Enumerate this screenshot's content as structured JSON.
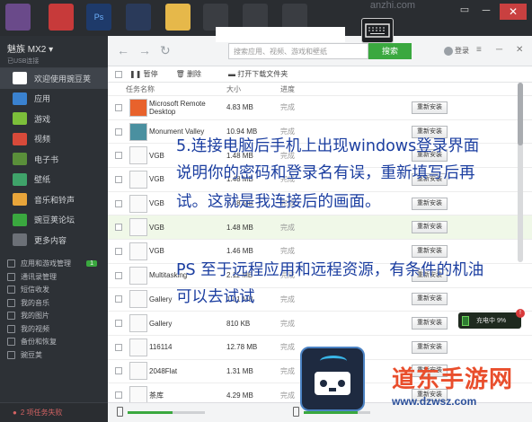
{
  "taskbar": {
    "watermark": "anzhi.com",
    "min_label": "─",
    "max_label": "▭",
    "close_label": "✕"
  },
  "device": {
    "name": "魅族 MX2 ▾",
    "subtitle": "已USB连接"
  },
  "menu": [
    {
      "label": "欢迎使用豌豆荚",
      "color": "#ffffff"
    },
    {
      "label": "应用",
      "color": "#3a82d0"
    },
    {
      "label": "游戏",
      "color": "#7cbf3a"
    },
    {
      "label": "视频",
      "color": "#d84a3a"
    },
    {
      "label": "电子书",
      "color": "#5a8f3a"
    },
    {
      "label": "壁纸",
      "color": "#3fa36a"
    },
    {
      "label": "音乐和铃声",
      "color": "#e8a53a"
    },
    {
      "label": "豌豆荚论坛",
      "color": "#3aa83f"
    },
    {
      "label": "更多内容",
      "color": "#6c7077"
    }
  ],
  "secondary_menu": [
    {
      "label": "应用和游戏管理",
      "badge": "1"
    },
    {
      "label": "通讯录管理",
      "badge": ""
    },
    {
      "label": "短信收发",
      "badge": ""
    },
    {
      "label": "我的音乐",
      "badge": ""
    },
    {
      "label": "我的图片",
      "badge": ""
    },
    {
      "label": "我的视频",
      "badge": ""
    },
    {
      "label": "备份和恢复",
      "badge": ""
    },
    {
      "label": "豌豆荚",
      "badge": ""
    }
  ],
  "sidebar_footer": "2 项任务失败",
  "topbar": {
    "back": "←",
    "forward": "→",
    "refresh": "↻",
    "search_placeholder": "搜索应用、视频、游戏和壁纸",
    "search_button": "搜索",
    "login": "登录",
    "menu_icon": "≡",
    "minimize": "─",
    "close": "✕"
  },
  "toolbar": {
    "pause": "暂停",
    "delete": "删除",
    "open_folder": "打开下载文件夹"
  },
  "columns": {
    "name": "任务名称",
    "size": "大小",
    "status": "进度"
  },
  "tasks": [
    {
      "name": "Microsoft Remote Desktop",
      "size": "4.83 MB",
      "status": "完成",
      "action": "重新安装",
      "color": "#e8622c"
    },
    {
      "name": "Monument Valley",
      "size": "10.94 MB",
      "status": "完成",
      "action": "重新安装",
      "color": "#4a90a0"
    },
    {
      "name": "VGB",
      "size": "1.48 MB",
      "status": "完成",
      "action": "重新安装",
      "color": "#fafafa"
    },
    {
      "name": "VGB",
      "size": "1.48 MB",
      "status": "完成",
      "action": "重新安装",
      "color": "#fafafa"
    },
    {
      "name": "VGB",
      "size": "1.48 MB",
      "status": "完成",
      "action": "重新安装",
      "color": "#fafafa"
    },
    {
      "name": "VGB",
      "size": "1.48 MB",
      "status": "完成",
      "action": "重新安装",
      "color": "#fafafa"
    },
    {
      "name": "VGB",
      "size": "1.46 MB",
      "status": "完成",
      "action": "重新安装",
      "color": "#fafafa"
    },
    {
      "name": "Multitasking",
      "size": "2.11 MB",
      "status": "完成",
      "action": "重新安装",
      "color": "#fafafa"
    },
    {
      "name": "Gallery",
      "size": "1.01 MB",
      "status": "完成",
      "action": "重新安装",
      "color": "#fafafa"
    },
    {
      "name": "Gallery",
      "size": "810 KB",
      "status": "完成",
      "action": "重新安装",
      "color": "#fafafa"
    },
    {
      "name": "116114",
      "size": "12.78 MB",
      "status": "完成",
      "action": "重新安装",
      "color": "#fafafa"
    },
    {
      "name": "2048Flat",
      "size": "1.31 MB",
      "status": "完成",
      "action": "重新安装",
      "color": "#fafafa"
    },
    {
      "name": "茶库",
      "size": "4.29 MB",
      "status": "完成",
      "action": "重新安装",
      "color": "#fafafa"
    }
  ],
  "charging": "充电中 9%",
  "charging_badge": "!",
  "overlay": {
    "line1": "5.连接电脑后手机上出现windows登录界面",
    "line2": "说明你的密码和登录名有误，重新填写后再",
    "line3": "试。这就是我连接后的画面。",
    "line4": "PS 至于远程应用和远程资源，有条件的机油",
    "line5": "可以去试试"
  },
  "watermark": {
    "brand": "道东手游网",
    "url": "www.dzwsz.com"
  }
}
